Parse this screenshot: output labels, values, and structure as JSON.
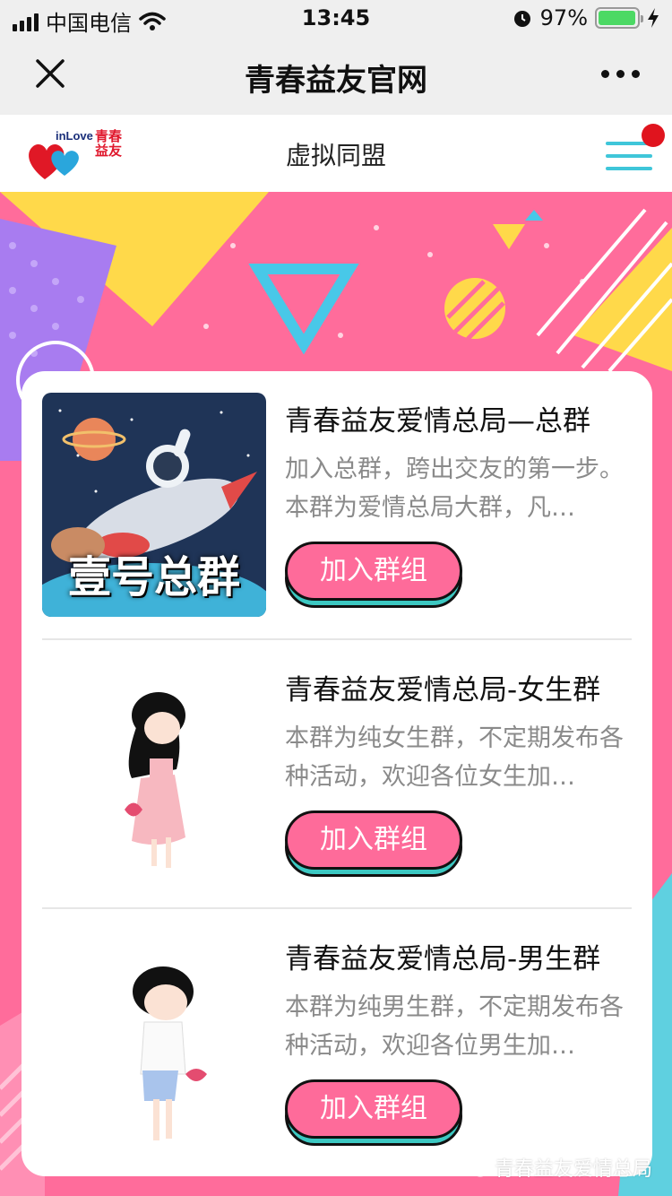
{
  "status_bar": {
    "carrier": "中国电信",
    "time": "13:45",
    "battery": "97%",
    "battery_level": 0.97
  },
  "navbar": {
    "title": "青春益友官网"
  },
  "site_header": {
    "logo_en": "inLove",
    "logo_cn": "青春益友",
    "title": "虚拟同盟"
  },
  "groups": [
    {
      "name": "青春益友爱情总局—总群",
      "description": "加入总群，跨出交友的第一步。本群为爱情总局大群，凡…",
      "button": "加入群组",
      "thumb_text": "壹号总群"
    },
    {
      "name": "青春益友爱情总局-女生群",
      "description": "本群为纯女生群，不定期发布各种活动，欢迎各位女生加…",
      "button": "加入群组"
    },
    {
      "name": "青春益友爱情总局-男生群",
      "description": "本群为纯男生群，不定期发布各种活动，欢迎各位男生加…",
      "button": "加入群组"
    }
  ],
  "watermark": "青春益友爱情总局",
  "colors": {
    "accent_pink": "#fe6b9a",
    "accent_teal": "#3cc8c2",
    "menu_blue": "#3fc6d9",
    "badge_red": "#e0141e"
  },
  "icons": [
    "signal-icon",
    "wifi-icon",
    "alarm-icon",
    "battery-icon",
    "charging-icon",
    "close-icon",
    "more-icon",
    "menu-icon",
    "wechat-icon"
  ]
}
